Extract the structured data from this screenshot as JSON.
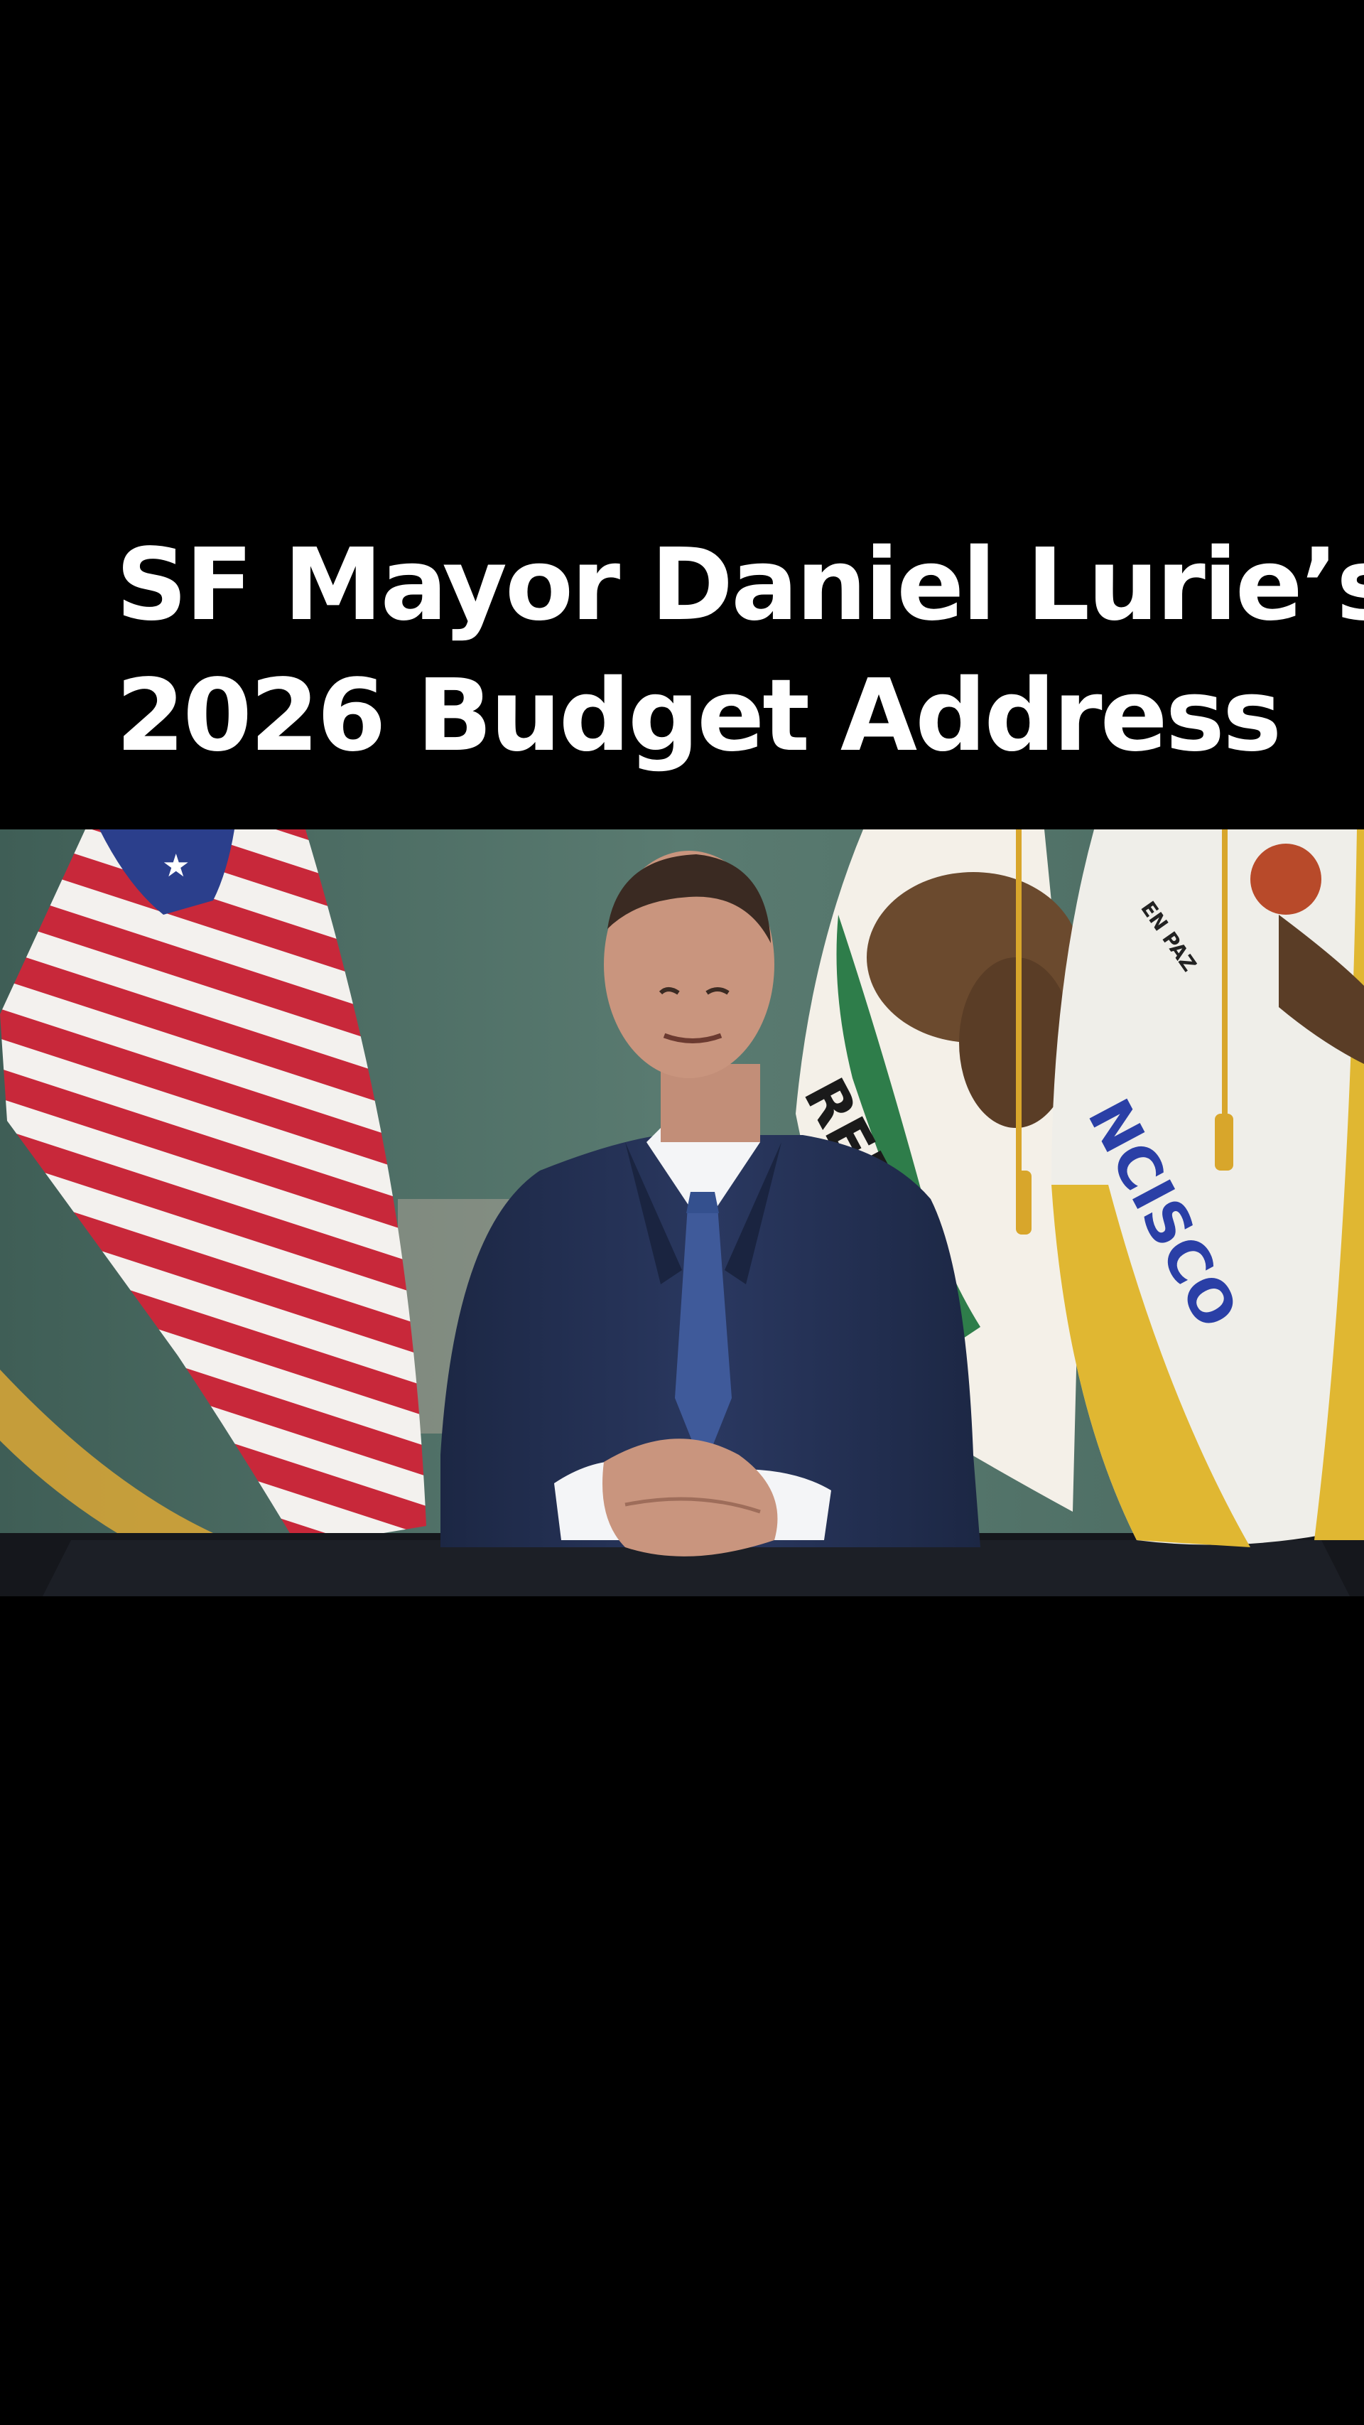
{
  "caption": {
    "line1": "SF Mayor Daniel Lurie’s",
    "line2": "2026 Budget Address"
  },
  "video": {
    "flag_texts": {
      "california": "REPU",
      "san_francisco": "NCISCO",
      "motto": "EN PAZ"
    }
  },
  "colors": {
    "background": "#000000",
    "caption_text": "#ffffff",
    "wall": "#4f6f65",
    "suit": "#23304f",
    "tie": "#3f5a9a",
    "desk": "#15171c"
  }
}
